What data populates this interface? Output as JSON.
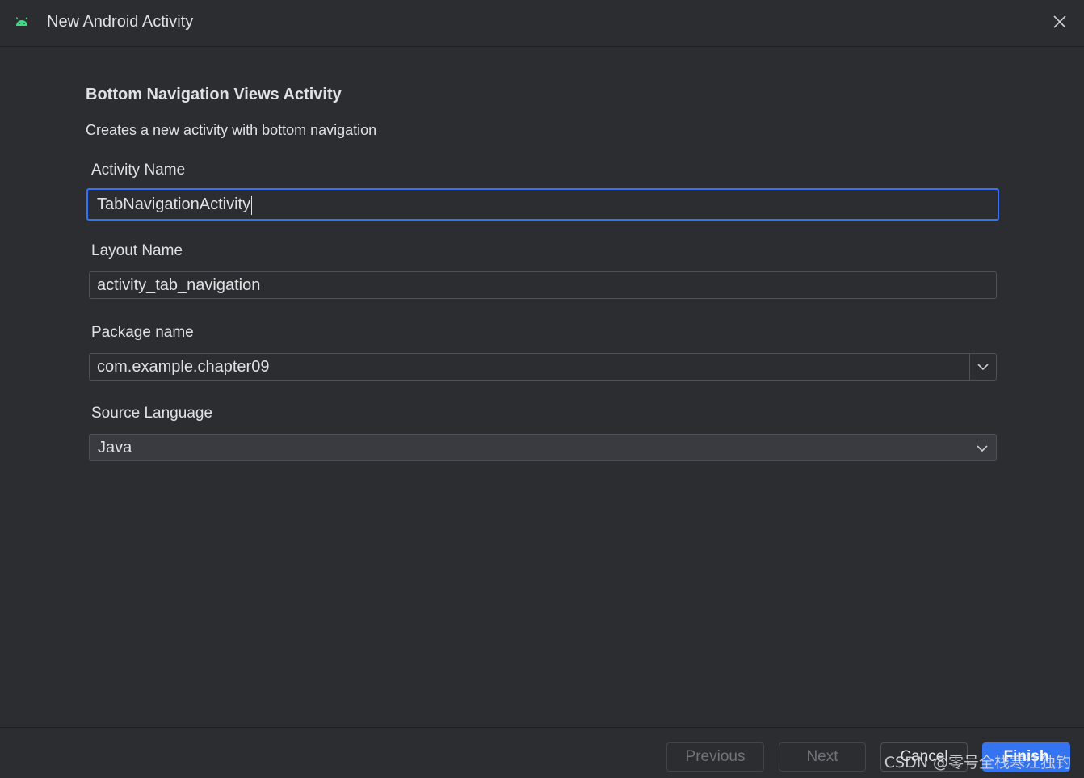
{
  "window": {
    "title": "New Android Activity",
    "icon": "android-icon",
    "close_icon": "close-icon"
  },
  "template": {
    "heading": "Bottom Navigation Views Activity",
    "description": "Creates a new activity with bottom navigation"
  },
  "fields": {
    "activity_name": {
      "label": "Activity Name",
      "value": "TabNavigationActivity"
    },
    "layout_name": {
      "label": "Layout Name",
      "value": "activity_tab_navigation"
    },
    "package_name": {
      "label": "Package name",
      "value": "com.example.chapter09"
    },
    "source_language": {
      "label": "Source Language",
      "value": "Java"
    }
  },
  "buttons": {
    "previous": "Previous",
    "next": "Next",
    "cancel": "Cancel",
    "finish": "Finish"
  },
  "watermark": "CSDN @零号全栈寒江独钓",
  "colors": {
    "background": "#2b2d30",
    "accent": "#3574f0",
    "android_green": "#3ddc84"
  }
}
